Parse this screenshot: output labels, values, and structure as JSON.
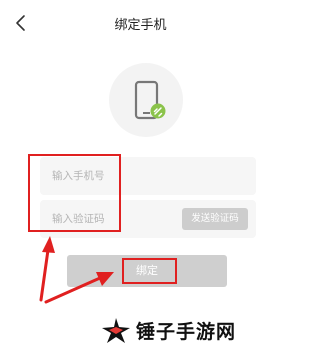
{
  "header": {
    "title": "绑定手机",
    "back_icon": "chevron-left-icon"
  },
  "avatar": {
    "icon": "phone-link-icon",
    "badge_color": "#8bc34a"
  },
  "form": {
    "phone_placeholder": "输入手机号",
    "code_placeholder": "输入验证码",
    "send_code_label": "发送验证码",
    "bind_label": "绑定"
  },
  "annotation": {
    "color": "#e02020"
  },
  "watermark": {
    "text": "锤子手游网",
    "logo_colors": [
      "#e53935",
      "#111111"
    ]
  }
}
